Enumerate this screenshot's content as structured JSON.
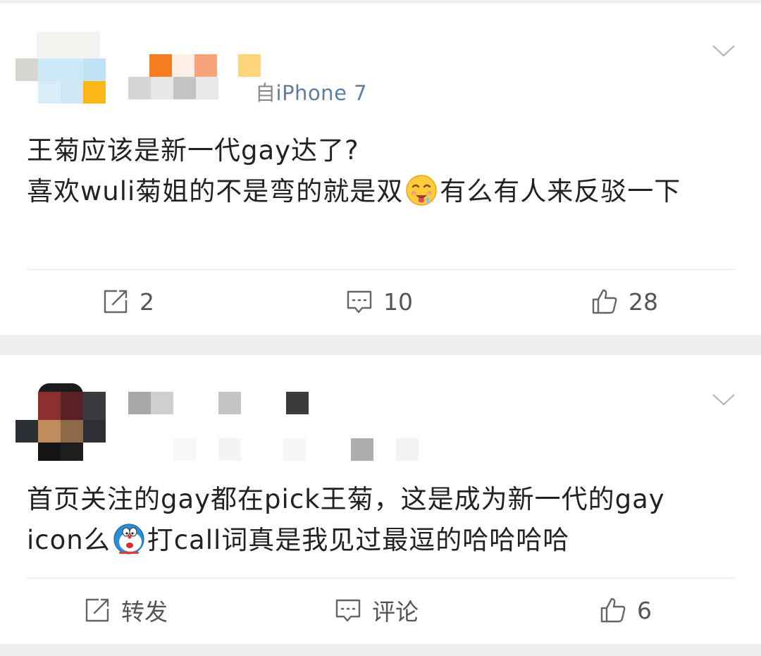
{
  "comments": [
    {
      "source_prefix": "自",
      "source": "iPhone 7",
      "text_line1": "王菊应该是新一代gay达了?",
      "text_line2a": "喜欢wuli菊姐的不是弯的就是双",
      "emoji_name": "drooling-face-emoji",
      "text_line2b": "有么有人来反驳一下",
      "repost": "2",
      "comments": "10",
      "likes": "28"
    },
    {
      "text_line1": "首页关注的gay都在pick王菊，这是成为新一代的gay",
      "text_line2a": "icon么",
      "emoji_name": "doraemon-emoji",
      "text_line2b": "打call词真是我见过最逗的哈哈哈哈",
      "repost": "转发",
      "comments": "评论",
      "likes": "6"
    }
  ],
  "colors": {
    "source_link": "#5f7e9d",
    "text": "#222222",
    "action_text": "#555555",
    "background": "#efefef",
    "card": "#ffffff"
  },
  "icons": {
    "repost": "repost-icon",
    "comment": "comment-icon",
    "like": "thumbs-up-icon",
    "menu": "chevron-down-icon"
  }
}
